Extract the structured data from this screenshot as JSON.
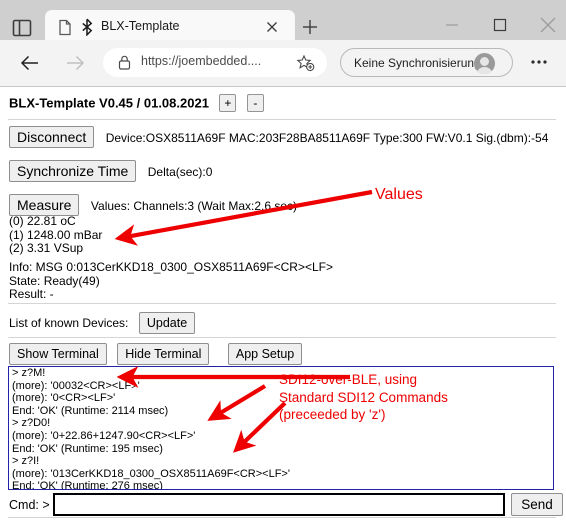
{
  "browser": {
    "tab": {
      "title": "BLX-Template",
      "favicon_name": "page-icon",
      "bluetooth_icon_name": "bluetooth-icon",
      "close_label": "×"
    },
    "new_tab_label": "+",
    "window_controls": {
      "minimize": "—",
      "maximize": "☐",
      "close": "✕"
    },
    "toolbar": {
      "back_label": "←",
      "forward_label": "→",
      "url": "https://joembedded....",
      "lock_icon_name": "lock-icon",
      "favorite_icon_name": "star-add-icon",
      "profile_label": "Keine Synchronisierung",
      "ellipsis_label": "…"
    }
  },
  "page": {
    "header": {
      "title": "BLX-Template V0.45 / 01.08.2021",
      "plus_label": "+",
      "minus_label": "-"
    },
    "connection": {
      "button_label": "Disconnect",
      "info": "Device:OSX8511A69F MAC:203F28BA8511A69F Type:300 FW:V0.1 Sig.(dbm):-54"
    },
    "sync": {
      "button_label": "Synchronize Time",
      "info": "Delta(sec):0"
    },
    "measure": {
      "button_label": "Measure",
      "info": "Values: Channels:3 (Wait Max:2.6 sec)",
      "values": [
        "(0) 22.81 oC",
        "(1) 1248.00 mBar",
        "(2) 3.31 VSup"
      ]
    },
    "status": {
      "info": "Info: MSG 0:013CerKKD18_0300_OSX8511A69F<CR><LF>",
      "state": "State: Ready(49)",
      "result": "Result: -"
    },
    "devices": {
      "label": "List of known Devices:",
      "update_label": "Update"
    },
    "terminal_controls": {
      "show_label": "Show Terminal",
      "hide_label": "Hide Terminal",
      "setup_label": "App Setup"
    },
    "terminal": {
      "lines": [
        "> z?M!",
        "(more): '00032<CR><LF>'",
        "(more): '0<CR><LF>'",
        "End: 'OK' (Runtime: 2114 msec)",
        "> z?D0!",
        "(more): '0+22.86+1247.90<CR><LF>'",
        "End: 'OK' (Runtime: 195 msec)",
        "> z?I!",
        "(more): '013CerKKD18_0300_OSX8511A69F<CR><LF>'",
        "End: 'OK' (Runtime: 276 msec)"
      ]
    },
    "cmd": {
      "label": "Cmd: >",
      "value": "",
      "placeholder": "",
      "send_label": "Send"
    }
  },
  "annotations": {
    "values_note": "Values",
    "sdi_note": "SDI12-over-BLE, using\nStandard SDI12 Commands\n(preceeded by 'z')",
    "color": "#ee0000"
  }
}
